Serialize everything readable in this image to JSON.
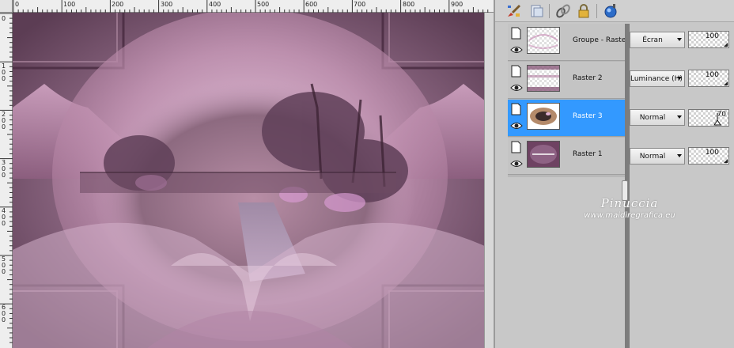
{
  "ruler": {
    "top_labels": [
      "0",
      "100",
      "200",
      "300",
      "400",
      "500",
      "600",
      "700",
      "800",
      "900"
    ],
    "left_labels": [
      "0",
      "1 0 0",
      "2 0 0",
      "3 0 0",
      "4 0 0",
      "5 0 0",
      "6 0 0"
    ]
  },
  "toolbar": {
    "icons": [
      "paint-brush-icon",
      "new-layer-icon",
      "link-icon",
      "lock-icon",
      "mask-icon"
    ]
  },
  "layers": [
    {
      "name": "Groupe - Raster 2",
      "blend": "Écran",
      "opacity": "100",
      "selected": false
    },
    {
      "name": "Raster 2",
      "blend": "Luminance (H)",
      "opacity": "100",
      "selected": false
    },
    {
      "name": "Raster 3",
      "blend": "Normal",
      "opacity": "70",
      "selected": true
    },
    {
      "name": "Raster 1",
      "blend": "Normal",
      "opacity": "100",
      "selected": false
    }
  ],
  "watermark": {
    "name": "Pinuccia",
    "url": "www.maidiregrafica.eu"
  },
  "colors": {
    "selection": "#3399ff",
    "artwork_base": "#7a5a70",
    "artwork_pink": "#c89ab8"
  }
}
